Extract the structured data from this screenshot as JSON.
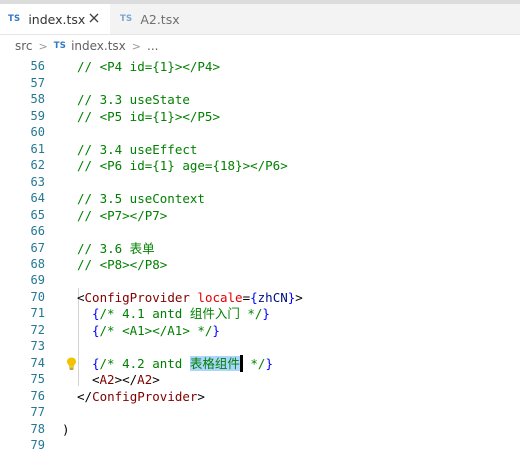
{
  "tabs": [
    {
      "badge": "TS",
      "label": "index.tsx",
      "active": true
    },
    {
      "badge": "TS",
      "label": "A2.tsx",
      "active": false
    }
  ],
  "breadcrumb": {
    "folder": "src",
    "badge": "TS",
    "file": "index.tsx",
    "trail": "..."
  },
  "editor": {
    "lines": [
      {
        "num": "56",
        "text": "// <P4 id={1}></P4>"
      },
      {
        "num": "57",
        "text": ""
      },
      {
        "num": "58",
        "text": "// 3.3 useState"
      },
      {
        "num": "59",
        "text": "// <P5 id={1}></P5>"
      },
      {
        "num": "60",
        "text": ""
      },
      {
        "num": "61",
        "text": "// 3.4 useEffect"
      },
      {
        "num": "62",
        "text": "// <P6 id={1} age={18}></P6>"
      },
      {
        "num": "63",
        "text": ""
      },
      {
        "num": "64",
        "text": "// 3.5 useContext"
      },
      {
        "num": "65",
        "text": "// <P7></P7>"
      },
      {
        "num": "66",
        "text": ""
      },
      {
        "num": "67",
        "text": "// 3.6 表单"
      },
      {
        "num": "68",
        "text": "// <P8></P8>"
      },
      {
        "num": "69",
        "text": ""
      },
      {
        "num": "70",
        "text": "<ConfigProvider locale={zhCN}>"
      },
      {
        "num": "71",
        "text": "{/* 4.1 antd 组件入门 */}"
      },
      {
        "num": "72",
        "text": "{/* <A1></A1> */}"
      },
      {
        "num": "73",
        "text": ""
      },
      {
        "num": "74",
        "text": "{/* 4.2 antd 表格组件 */}"
      },
      {
        "num": "75",
        "text": "<A2></A2>"
      },
      {
        "num": "76",
        "text": "</ConfigProvider>"
      },
      {
        "num": "77",
        "text": ""
      },
      {
        "num": "78",
        "text": ")"
      },
      {
        "num": "79",
        "text": ""
      }
    ],
    "segments": {
      "l70_open": "<",
      "l70_tag": "ConfigProvider",
      "l70_attr": "locale",
      "l70_eq": "=",
      "l70_brace_open": "{",
      "l70_ident": "zhCN",
      "l70_brace_close": "}",
      "l70_close": ">",
      "l71_brace_open": "{",
      "l71_comment": "/* 4.1 antd 组件入门 */",
      "l71_brace_close": "}",
      "l72_brace_open": "{",
      "l72_comment": "/* <A1></A1> */",
      "l72_brace_close": "}",
      "l74_brace_open": "{",
      "l74_comment_pre": "/* 4.2 antd ",
      "l74_highlight": "表格组件",
      "l74_comment_post": " */",
      "l74_brace_close": "}",
      "l75_open": "<",
      "l75_tag1": "A2",
      "l75_mid": "></",
      "l75_tag2": "A2",
      "l75_close": ">",
      "l76_open": "</",
      "l76_tag": "ConfigProvider",
      "l76_close": ">",
      "l78_text": ")"
    },
    "lightbulb": "lightbulb-icon"
  },
  "colors": {
    "comment": "#008000",
    "tag": "#800000",
    "attribute": "#e50000",
    "brace": "#0000ff",
    "line_number": "#237893",
    "selection": "#add6ff",
    "ts_badge": "#3178c6"
  }
}
